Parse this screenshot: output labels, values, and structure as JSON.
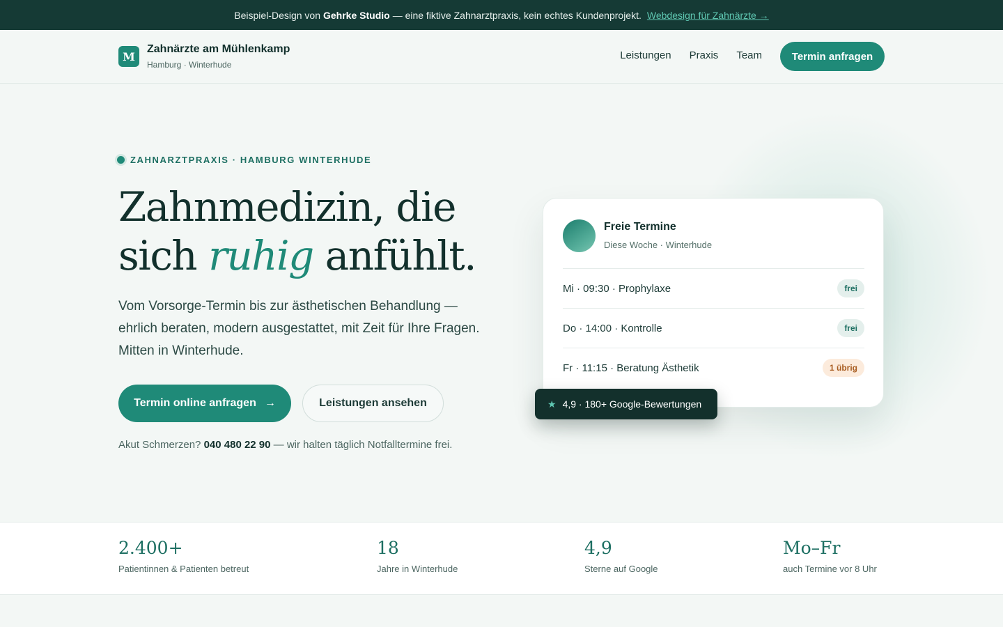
{
  "banner": {
    "prefix": "Beispiel-Design von",
    "studio": "Gehrke Studio",
    "suffix": "— eine fiktive Zahnarztpraxis, kein echtes Kundenprojekt.",
    "link": "Webdesign für Zahnärzte →"
  },
  "header": {
    "logo_letter": "M",
    "brand_name": "Zahnärzte am Mühlenkamp",
    "brand_sub": "Hamburg · Winterhude",
    "nav": [
      "Leistungen",
      "Praxis",
      "Team"
    ],
    "cta": "Termin anfragen"
  },
  "hero": {
    "eyebrow": "ZAHNARZTPRAXIS · HAMBURG WINTERHUDE",
    "title_line1": "Zahnmedizin, die",
    "title_line2_start": "sich",
    "title_emphasis": "ruhig",
    "title_line2_end": "anfühlt.",
    "lead": "Vom Vorsorge-Termin bis zur ästhetischen Behandlung — ehrlich beraten, modern ausgestattet, mit Zeit für Ihre Fragen. Mitten in Winterhude.",
    "primary_button": "Termin online anfragen",
    "primary_arrow": "→",
    "secondary_button": "Leistungen ansehen",
    "urgent_prefix": "Akut Schmerzen?",
    "urgent_phone": "040 480 22 90",
    "urgent_suffix": "— wir halten täglich Notfalltermine frei."
  },
  "appointments": {
    "title": "Freie Termine",
    "subtitle": "Diese Woche · Winterhude",
    "slots": [
      {
        "label": "Mi · 09:30 · Prophylaxe",
        "badge": "frei"
      },
      {
        "label": "Do · 14:00 · Kontrolle",
        "badge": "frei"
      },
      {
        "label": "Fr · 11:15 · Beratung Ästhetik",
        "badge": "1 übrig"
      }
    ]
  },
  "rating_toast": {
    "star": "★",
    "text": "4,9 · 180+ Google-Bewertungen"
  },
  "stats": [
    {
      "value": "2.400+",
      "label": "Patientinnen & Patienten betreut"
    },
    {
      "value": "18",
      "label": "Jahre in Winterhude"
    },
    {
      "value": "4,9",
      "label": "Sterne auf Google"
    },
    {
      "value": "Mo–Fr",
      "label": "auch Termine vor 8 Uhr"
    }
  ],
  "colors": {
    "accent": "#1f8a78",
    "dark": "#153a35",
    "background": "#f3f7f5",
    "warning_badge": "#fcebdc"
  }
}
